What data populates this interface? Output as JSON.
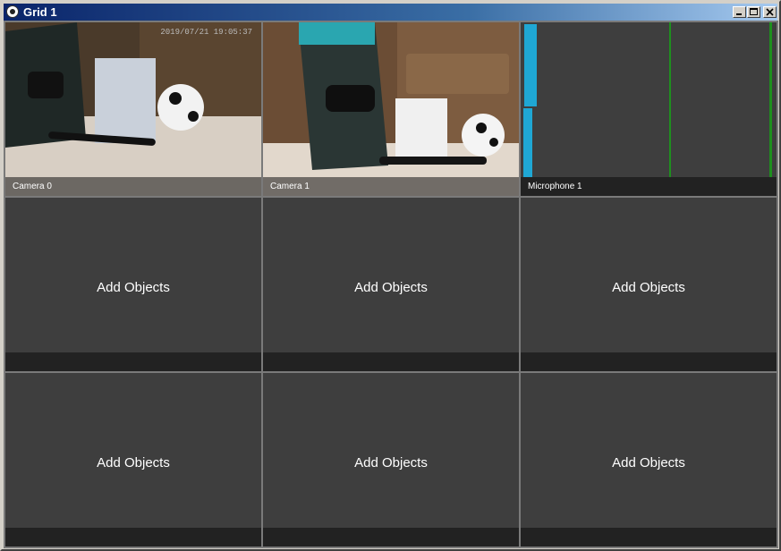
{
  "window": {
    "title": "Grid 1"
  },
  "cells": [
    {
      "caption": "Camera 0",
      "type": "camera",
      "timestamp": "2019/07/21 19:05:37"
    },
    {
      "caption": "Camera 1",
      "type": "camera"
    },
    {
      "caption": "Microphone 1",
      "type": "microphone"
    },
    {
      "placeholder": "Add Objects",
      "type": "empty"
    },
    {
      "placeholder": "Add Objects",
      "type": "empty"
    },
    {
      "placeholder": "Add Objects",
      "type": "empty"
    },
    {
      "placeholder": "Add Objects",
      "type": "empty"
    },
    {
      "placeholder": "Add Objects",
      "type": "empty"
    },
    {
      "placeholder": "Add Objects",
      "type": "empty"
    }
  ],
  "colors": {
    "titlebar_start": "#0a246a",
    "cell_bg": "#3e3e3e",
    "audio_bar": "#1fa7d4",
    "audio_line": "#1e8f1e"
  }
}
